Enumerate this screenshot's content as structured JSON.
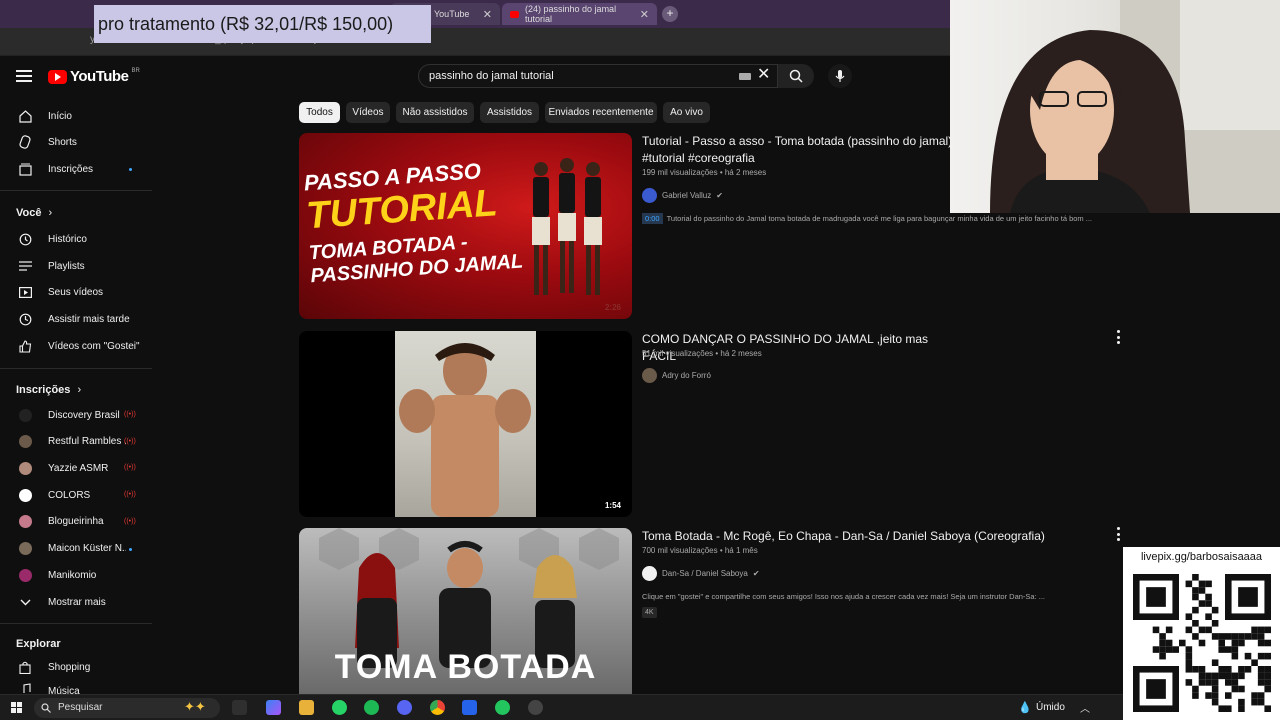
{
  "overlay": {
    "donation_text": "pro tratamento (R$ 32,01/R$ 150,00)"
  },
  "browser": {
    "tabs": [
      {
        "label": "YouTube",
        "active": false
      },
      {
        "label": "(24) passinho do jamal tutorial",
        "active": true
      }
    ],
    "address": "youtube.com/results?search_query=passinho+do+jamal+tutorial"
  },
  "header": {
    "logo_text": "YouTube",
    "country": "BR",
    "search_value": "passinho do jamal tutorial"
  },
  "sidebar": {
    "main": [
      {
        "label": "Início",
        "icon": "home-icon"
      },
      {
        "label": "Shorts",
        "icon": "shorts-icon"
      },
      {
        "label": "Inscrições",
        "icon": "subscriptions-icon"
      }
    ],
    "you_heading": "Você",
    "you": [
      {
        "label": "Histórico",
        "icon": "history-icon"
      },
      {
        "label": "Playlists",
        "icon": "playlists-icon"
      },
      {
        "label": "Seus vídeos",
        "icon": "your-videos-icon"
      },
      {
        "label": "Assistir mais tarde",
        "icon": "watch-later-icon"
      },
      {
        "label": "Vídeos com \"Gostei\"",
        "icon": "liked-icon"
      }
    ],
    "subs_heading": "Inscrições",
    "subs": [
      {
        "label": "Discovery Brasil",
        "status": "live",
        "color": "#222222"
      },
      {
        "label": "Restful Rambles ...",
        "status": "live",
        "color": "#6b5a4a"
      },
      {
        "label": "Yazzie ASMR",
        "status": "live",
        "color": "#b08a7a"
      },
      {
        "label": "COLORS",
        "status": "live",
        "color": "#ffffff"
      },
      {
        "label": "Blogueirinha",
        "status": "live",
        "color": "#c47a8a"
      },
      {
        "label": "Maicon Küster N...",
        "status": "new",
        "color": "#7a6a5a"
      },
      {
        "label": "Manikomio",
        "status": "none",
        "color": "#9a2a6a"
      }
    ],
    "show_more": "Mostrar mais",
    "explore_heading": "Explorar",
    "explore": [
      {
        "label": "Shopping",
        "icon": "shopping-icon"
      },
      {
        "label": "Música",
        "icon": "music-icon"
      }
    ]
  },
  "chips": [
    "Todos",
    "Vídeos",
    "Não assistidos",
    "Assistidos",
    "Enviados recentemente",
    "Ao vivo"
  ],
  "results": [
    {
      "title": "Tutorial - Passo a asso - Toma botada (passinho do jamal) #tutorial #coreografia",
      "views": "199 mil visualizações",
      "age": "há 2 meses",
      "channel": "Gabriel Valluz",
      "verified": true,
      "chapter_time": "0:00",
      "description": "Tutorial do passinho do Jamal toma botada de madrugada você me liga para bagunçar minha vida de um jeito facinho tá bom ...",
      "duration": "2:26",
      "thumb_lines": [
        "PASSO A PASSO",
        "TUTORIAL",
        "TOMA BOTADA -",
        "PASSINHO DO JAMAL"
      ]
    },
    {
      "title": "COMO DANÇAR O PASSINHO DO JAMAL ,jeito mas FÁCIL",
      "views": "51 mil visualizações",
      "age": "há 2 meses",
      "channel": "Adry do Forró",
      "verified": false,
      "duration": "1:54"
    },
    {
      "title": "Toma Botada - Mc Rogê, Eo Chapa - Dan-Sa / Daniel Saboya (Coreografia)",
      "views": "700 mil visualizações",
      "age": "há 1 mês",
      "channel": "Dan-Sa / Daniel Saboya",
      "verified": true,
      "description": "Clique em \"gostei\" e compartilhe com seus amigos! Isso nos ajuda a crescer cada vez mais! Seja um instrutor Dan-Sa: ...",
      "badge": "4K",
      "thumb_text": "TOMA BOTADA"
    }
  ],
  "qr": {
    "label": "livepix.gg/barbosaisaaaa"
  },
  "taskbar": {
    "search_placeholder": "Pesquisar",
    "weather": "Úmido"
  }
}
